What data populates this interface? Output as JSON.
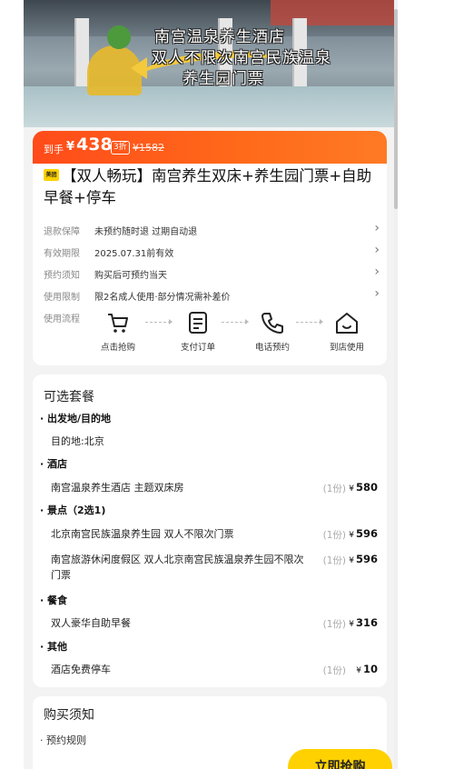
{
  "hero": {
    "caption_line1": "南宫温泉养生酒店",
    "caption_line2": "双人不限次南宫民族温泉",
    "caption_line3": "养生园门票"
  },
  "price": {
    "prefix": "到手",
    "currency": "¥",
    "value": "438",
    "discount": "3折",
    "original": "¥1582"
  },
  "product": {
    "badge": "美团",
    "title": "【双人畅玩】南宫养生双床+养生园门票+自助早餐+停车"
  },
  "info_rows": [
    {
      "label": "退款保障",
      "text": "未预约随时退 过期自动退"
    },
    {
      "label": "有效期限",
      "text": "2025.07.31前有效"
    },
    {
      "label": "预约须知",
      "text": "购买后可预约当天"
    },
    {
      "label": "使用限制",
      "text": "限2名成人使用·部分情况需补差价"
    }
  ],
  "flow": {
    "label": "使用流程",
    "steps": [
      {
        "icon": "cart-icon",
        "label": "点击抢购"
      },
      {
        "icon": "order-icon",
        "label": "支付订单"
      },
      {
        "icon": "phone-icon",
        "label": "电话预约"
      },
      {
        "icon": "home-icon",
        "label": "到店使用"
      }
    ]
  },
  "packages": {
    "title": "可选套餐",
    "sections": {
      "departure": {
        "heading": "· 出发地/目的地",
        "line": "目的地:北京"
      },
      "hotel": {
        "heading": "· 酒店",
        "items": [
          {
            "name": "南宫温泉养生酒店 主题双床房",
            "qty": "(1份)",
            "price": "580"
          }
        ]
      },
      "attractions": {
        "heading": "· 景点（2选1)",
        "items": [
          {
            "name": "北京南宫民族温泉养生园 双人不限次门票",
            "qty": "(1份)",
            "price": "596"
          },
          {
            "name": "南宫旅游休闲度假区 双人北京南宫民族温泉养生园不限次门票",
            "qty": "(1份)",
            "price": "596"
          }
        ]
      },
      "meals": {
        "heading": "· 餐食",
        "items": [
          {
            "name": "双人豪华自助早餐",
            "qty": "(1份)",
            "price": "316"
          }
        ]
      },
      "other": {
        "heading": "· 其他",
        "items": [
          {
            "name": "酒店免费停车",
            "qty": "(1份)",
            "price": "10"
          }
        ]
      }
    },
    "currency": "¥"
  },
  "notes": {
    "title": "购买须知",
    "sub": "· 预约规则"
  },
  "buy_button": "立即抢购",
  "colors": {
    "accent": "#ff5a1a",
    "buy_button": "#ffd100"
  }
}
